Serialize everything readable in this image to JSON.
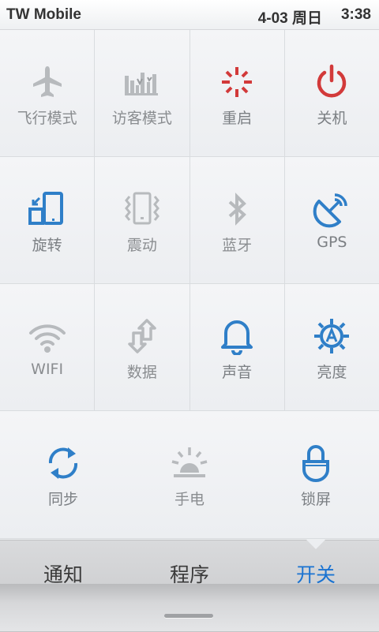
{
  "status": {
    "carrier": "TW Mobile",
    "date": "4-03 周日",
    "time": "3:38"
  },
  "toggles": [
    {
      "label": "飞行模式",
      "icon": "airplane-icon",
      "on": false
    },
    {
      "label": "访客模式",
      "icon": "guest-mode-icon",
      "on": false
    },
    {
      "label": "重启",
      "icon": "restart-icon",
      "on": true
    },
    {
      "label": "关机",
      "icon": "power-icon",
      "on": true
    },
    {
      "label": "旋转",
      "icon": "rotate-icon",
      "on": true
    },
    {
      "label": "震动",
      "icon": "vibrate-icon",
      "on": false
    },
    {
      "label": "蓝牙",
      "icon": "bluetooth-icon",
      "on": false
    },
    {
      "label": "GPS",
      "icon": "gps-icon",
      "on": true
    },
    {
      "label": "WIFI",
      "icon": "wifi-icon",
      "on": false
    },
    {
      "label": "数据",
      "icon": "data-icon",
      "on": false
    },
    {
      "label": "声音",
      "icon": "sound-icon",
      "on": true
    },
    {
      "label": "亮度",
      "icon": "brightness-icon",
      "on": true
    },
    {
      "label": "同步",
      "icon": "sync-icon",
      "on": true
    },
    {
      "label": "手电",
      "icon": "flashlight-icon",
      "on": false
    },
    {
      "label": "锁屏",
      "icon": "lock-screen-icon",
      "on": true
    }
  ],
  "tabs": [
    {
      "label": "通知",
      "active": false
    },
    {
      "label": "程序",
      "active": false
    },
    {
      "label": "开关",
      "active": true
    }
  ],
  "colors": {
    "blue": "#2f7fc8",
    "red": "#d23a3a",
    "gray": "#b9bcbf",
    "active_tab": "#1a73d1"
  }
}
